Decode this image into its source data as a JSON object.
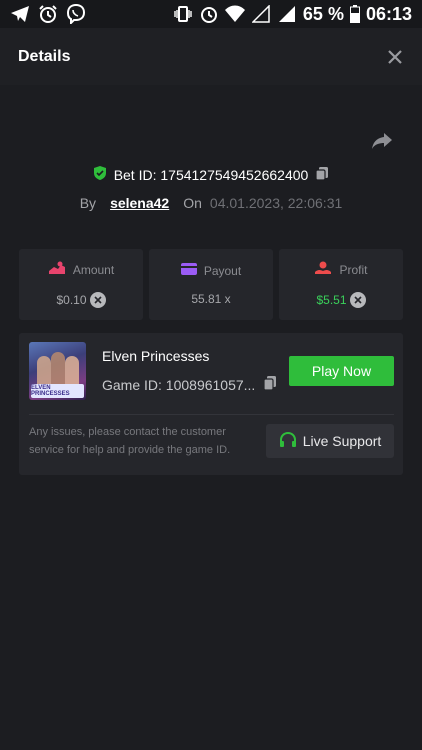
{
  "statusbar": {
    "battery": "65 %",
    "time": "06:13",
    "left_icons": [
      "telegram-icon",
      "alarm-icon",
      "viber-icon"
    ],
    "right_icons": [
      "vibrate-icon",
      "alarm-icon",
      "wifi-icon",
      "signal-icon",
      "signal-icon",
      "battery-icon"
    ]
  },
  "header": {
    "title": "Details",
    "close_icon": "close-icon"
  },
  "bet": {
    "share_icon": "share-icon",
    "id_label": "Bet ID: 1754127549452662400",
    "by_label": "By",
    "user": "selena42",
    "on_label": "On",
    "date": "04.01.2023, 22:06:31"
  },
  "stats": [
    {
      "label": "Amount",
      "value": "$0.10",
      "icon": "amount-icon",
      "has_x": true,
      "color": "#e8446d"
    },
    {
      "label": "Payout",
      "value": "55.81 x",
      "icon": "payout-card-icon",
      "has_x": false,
      "color": "#9b5cf5"
    },
    {
      "label": "Profit",
      "value": "$5.51",
      "icon": "profit-icon",
      "has_x": true,
      "color": "#ee4c4c"
    }
  ],
  "game": {
    "name": "Elven Princesses",
    "id_label": "Game ID: 1008961057...",
    "thumb_text": "ELVEN PRINCESSES",
    "play_label": "Play Now"
  },
  "support": {
    "text": "Any issues, please contact the customer service for help and provide the game ID.",
    "button_label": "Live Support"
  },
  "colors": {
    "accent_green": "#2fbd3b",
    "profit_green": "#3ad05a",
    "background": "#1c1d21"
  }
}
